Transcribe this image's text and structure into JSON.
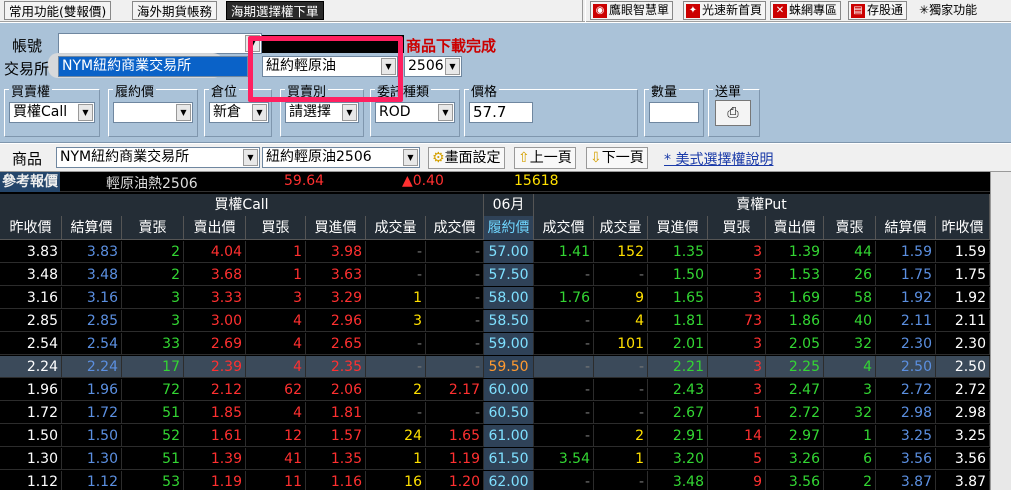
{
  "topbar": {
    "tabs": [
      "常用功能(雙報價)",
      "海外期貨帳務",
      "海期選擇權下單"
    ],
    "active_tab": 2,
    "quick_buttons": [
      "鷹眼智慧單",
      "光速新首頁",
      "蛛網專區",
      "存股通",
      "獨家功能"
    ]
  },
  "order": {
    "account_label": "帳號",
    "exchange_label": "交易所",
    "exchange_value": "NYM紐約商業交易所",
    "product_value": "紐約輕原油",
    "month_value": "2506",
    "message": "商品下載完成",
    "groups": [
      {
        "title": "買賣權",
        "value": "買權Call"
      },
      {
        "title": "履約價",
        "value": ""
      },
      {
        "title": "倉位",
        "value": "新倉"
      },
      {
        "title": "買賣別",
        "value": "請選擇"
      },
      {
        "title": "委託種類",
        "value": "ROD"
      },
      {
        "title": "價格",
        "value": "57.7"
      },
      {
        "title": "數量",
        "value": ""
      },
      {
        "title": "送單",
        "value": ""
      }
    ]
  },
  "product_bar": {
    "label": "商品",
    "exchange": "NYM紐約商業交易所",
    "product": "紐約輕原油2506",
    "buttons": [
      "畫面設定",
      "上一頁",
      "下一頁"
    ],
    "link": "* 美式選擇權說明"
  },
  "reference": {
    "label": "參考報價",
    "name": "輕原油熱2506",
    "price": "59.64",
    "change": "▲0.40",
    "volume": "15618"
  },
  "table": {
    "call_title": "買權Call",
    "month": "06月",
    "put_title": "賣權Put",
    "headers": [
      "昨收價",
      "結算價",
      "賣張",
      "賣出價",
      "買張",
      "買進價",
      "成交量",
      "成交價",
      "履約價",
      "成交價",
      "成交量",
      "買進價",
      "買張",
      "賣出價",
      "賣張",
      "結算價",
      "昨收價"
    ],
    "rows": [
      [
        "3.83",
        "3.83",
        "2",
        "4.04",
        "1",
        "3.98",
        "-",
        "-",
        "57.00",
        "1.41",
        "152",
        "1.35",
        "3",
        "1.39",
        "44",
        "1.59",
        "1.59"
      ],
      [
        "3.48",
        "3.48",
        "2",
        "3.68",
        "1",
        "3.63",
        "-",
        "-",
        "57.50",
        "-",
        "-",
        "1.50",
        "3",
        "1.53",
        "26",
        "1.75",
        "1.75"
      ],
      [
        "3.16",
        "3.16",
        "3",
        "3.33",
        "3",
        "3.29",
        "1",
        "-",
        "58.00",
        "1.76",
        "9",
        "1.65",
        "3",
        "1.69",
        "58",
        "1.92",
        "1.92"
      ],
      [
        "2.85",
        "2.85",
        "3",
        "3.00",
        "4",
        "2.96",
        "3",
        "-",
        "58.50",
        "-",
        "4",
        "1.81",
        "73",
        "1.86",
        "40",
        "2.11",
        "2.11"
      ],
      [
        "2.54",
        "2.54",
        "33",
        "2.69",
        "4",
        "2.65",
        "-",
        "-",
        "59.00",
        "-",
        "101",
        "2.01",
        "3",
        "2.05",
        "32",
        "2.30",
        "2.30"
      ],
      [
        "2.24",
        "2.24",
        "17",
        "2.39",
        "4",
        "2.35",
        "-",
        "-",
        "59.50",
        "-",
        "-",
        "2.21",
        "3",
        "2.25",
        "4",
        "2.50",
        "2.50"
      ],
      [
        "1.96",
        "1.96",
        "72",
        "2.12",
        "62",
        "2.06",
        "2",
        "2.17",
        "60.00",
        "-",
        "-",
        "2.43",
        "3",
        "2.47",
        "3",
        "2.72",
        "2.72"
      ],
      [
        "1.72",
        "1.72",
        "51",
        "1.85",
        "4",
        "1.81",
        "-",
        "-",
        "60.50",
        "-",
        "-",
        "2.67",
        "1",
        "2.72",
        "32",
        "2.98",
        "2.98"
      ],
      [
        "1.50",
        "1.50",
        "52",
        "1.61",
        "12",
        "1.57",
        "24",
        "1.65",
        "61.00",
        "-",
        "2",
        "2.91",
        "14",
        "2.97",
        "1",
        "3.25",
        "3.25"
      ],
      [
        "1.30",
        "1.30",
        "51",
        "1.39",
        "41",
        "1.35",
        "1",
        "1.19",
        "61.50",
        "3.54",
        "1",
        "3.20",
        "5",
        "3.26",
        "6",
        "3.56",
        "3.56"
      ],
      [
        "1.12",
        "1.12",
        "53",
        "1.19",
        "11",
        "1.16",
        "16",
        "1.20",
        "62.00",
        "-",
        "-",
        "3.48",
        "9",
        "3.56",
        "2",
        "3.87",
        "3.87"
      ]
    ],
    "highlight_row": 5
  }
}
